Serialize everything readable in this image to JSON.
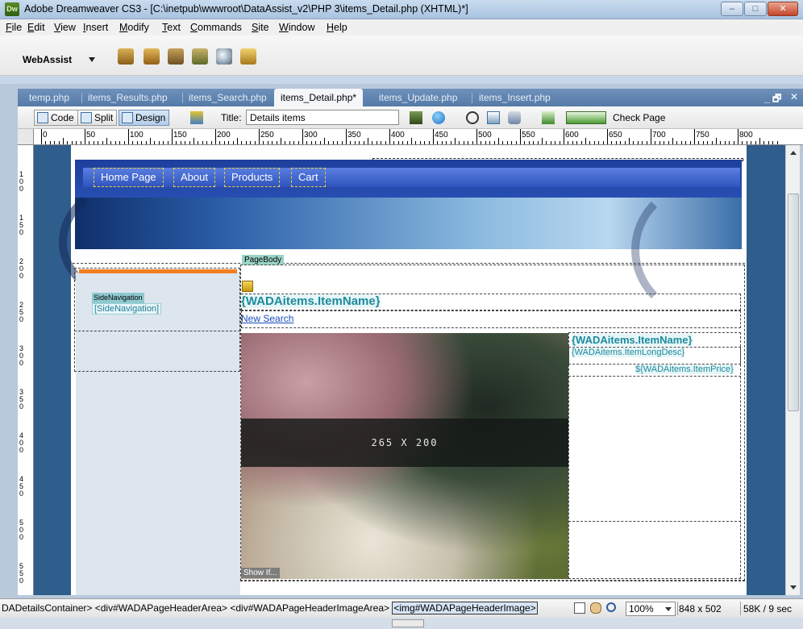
{
  "window": {
    "app_icon": "Dw",
    "title": "Adobe Dreamweaver CS3 - [C:\\inetpub\\wwwroot\\DataAssist_v2\\PHP 3\\items_Detail.php (XHTML)*]",
    "min": "–",
    "max": "□",
    "close": "✕"
  },
  "menu": [
    "File",
    "Edit",
    "View",
    "Insert",
    "Modify",
    "Text",
    "Commands",
    "Site",
    "Window",
    "Help"
  ],
  "toolbar": {
    "webassist_label": "WebAssist"
  },
  "tabs": [
    {
      "label": "temp.php"
    },
    {
      "label": "items_Results.php"
    },
    {
      "label": "items_Search.php"
    },
    {
      "label": "items_Detail.php*",
      "active": true
    },
    {
      "label": "items_Update.php"
    },
    {
      "label": "items_Insert.php"
    }
  ],
  "doc_controls": {
    "restore": "_ 🗗",
    "close": "✕"
  },
  "design_toolbar": {
    "code_label": "Code",
    "split_label": "Split",
    "design_label": "Design",
    "title_label": "Title:",
    "title_value": "Details items",
    "check_page_label": "Check Page"
  },
  "ruler": [
    "0",
    "50",
    "100",
    "150",
    "200",
    "250",
    "300",
    "350",
    "400",
    "450",
    "500",
    "550",
    "600",
    "650",
    "700",
    "750",
    "800"
  ],
  "ruler_v": [
    "1 0 0",
    "1 5 0",
    "2 0 0",
    "2 5 0",
    "3 0 0",
    "3 5 0",
    "4 0 0",
    "4 5 0",
    "5 0 0",
    "5 5 0"
  ],
  "page": {
    "nav": [
      "Home Page",
      "About",
      "Products",
      "Cart"
    ],
    "pagebody_tag": "PageBody",
    "sidenav_tag": "SideNavigation",
    "sidenav_text": "[SideNavigation]",
    "item_name": "{WADAitems.ItemName}",
    "new_search": "New Search",
    "photo_dims": "265 X 200",
    "show_if": "Show If...",
    "right_item_name": "{WADAitems.ItemName}",
    "right_long_desc": "{WADAitems.ItemLongDesc}",
    "right_price": "${WADAitems.ItemPrice}"
  },
  "status": {
    "tag_path_prefix": "DADetailsContainer> <div#WADAPageHeaderArea> <div#WADAPageHeaderImageArea> ",
    "selected_tag": "<img#WADAPageHeaderImage>",
    "zoom": "100%",
    "dimensions": "848 x 502",
    "size_time": "58K / 9 sec"
  },
  "colors": {
    "accent": "#f07f1f",
    "nav_blue": "#284eb2",
    "canvas_bg": "#2f5d8c",
    "tag_bg": "#8ec9cf"
  }
}
